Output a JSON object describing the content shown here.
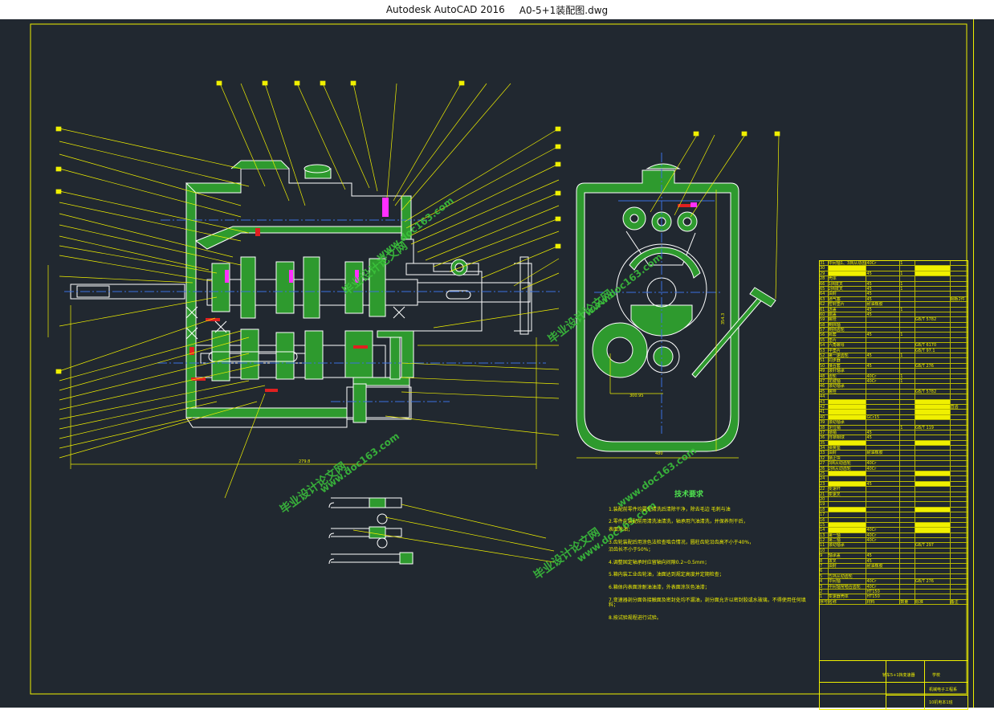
{
  "window": {
    "app_name": "Autodesk AutoCAD 2016",
    "file_name": "A0-5+1装配图.dwg"
  },
  "notes": {
    "title": "技术要求",
    "lines": [
      "1.装配前零件均要先清洗后清除干净，除去毛边 毛刺与油",
      "2.零件在装配前用清洗油清洗，轴承用汽油清洗，并保养剂干后，",
      "3.齿轮装配后用涂色法检查啮合情况，圆柱齿轮沿齿高不小于40%，",
      "4.调整固定轴承时应留轴向间隙0.2~0.5mm；",
      "5.箱内装工业齿轮油，油面达到规定高度并定期检查；",
      "6.箱体内表面涂耐油油漆，外表面涂灰色油漆；",
      "7.变速器剖分面各接触面及密封处均不漏油，剖分面允许以密封胶或水玻璃，不得使用任何填料；",
      "8.按试验规程进行试验。"
    ],
    "sub_lines": [
      "表面涂油；",
      "沿齿长不小于50%；"
    ]
  },
  "watermarks": [
    {
      "text": "毕业设计论文网",
      "size": 14
    },
    {
      "text": "www.doc163.com",
      "size": 12
    }
  ],
  "title_block": {
    "drawing_name": "轿车5+1挡变速器",
    "school": "学校",
    "dept": "机械电子工程系",
    "code": "10机电本1班"
  },
  "dimensions": {
    "width_main": "279.8",
    "width_side": "480",
    "height_side": "354.3",
    "center": "300.95"
  },
  "parts_table": {
    "rows": [
      [
        "31",
        "中间轴1、3挡从动齿轮",
        "40Cr",
        "1",
        "",
        ""
      ],
      [
        "30",
        "",
        "",
        "",
        "",
        ""
      ],
      [
        "29",
        "垫片",
        "45",
        "1",
        "",
        ""
      ],
      [
        "28",
        "壳体",
        "",
        "",
        "",
        ""
      ],
      [
        "66",
        "1挡拨叉",
        "45",
        "1",
        "",
        ""
      ],
      [
        "65",
        "2挡拨叉",
        "45",
        "1",
        "",
        ""
      ],
      [
        "64",
        "油封",
        "45",
        "",
        "",
        ""
      ],
      [
        "63",
        "通气塞",
        "45",
        "",
        "",
        "钢板2件"
      ],
      [
        "62",
        "密封垫片",
        "耐油橡胶",
        "",
        "",
        ""
      ],
      [
        "61",
        "透盖",
        "45",
        "1",
        "",
        ""
      ],
      [
        "60",
        "端盖",
        "45",
        "",
        "",
        ""
      ],
      [
        "59",
        "螺栓",
        "",
        "",
        "GB/T 5782",
        ""
      ],
      [
        "58",
        "倒挡轴",
        "",
        "",
        "",
        ""
      ],
      [
        "57",
        "倒挡齿轮",
        "",
        "",
        "",
        ""
      ],
      [
        "56",
        "隔套",
        "45",
        "1",
        "",
        ""
      ],
      [
        "55",
        "垫片",
        "",
        "",
        "",
        ""
      ],
      [
        "54",
        "六角螺母",
        "",
        "",
        "GB/T 6170",
        ""
      ],
      [
        "53",
        "平垫片",
        "",
        "",
        "GB/T 97.1",
        ""
      ],
      [
        "52",
        "第一速齿轮",
        "45",
        "1",
        "",
        ""
      ],
      [
        "51",
        "同步器",
        "",
        "",
        "",
        ""
      ],
      [
        "50",
        "接合套",
        "45",
        "",
        "GB/T 276",
        ""
      ],
      [
        "49",
        "滚针轴承",
        "",
        "",
        "",
        ""
      ],
      [
        "48",
        "齿轮",
        "40Cr",
        "1",
        "",
        ""
      ],
      [
        "47",
        "花键轴",
        "40Cr",
        "1",
        "",
        ""
      ],
      [
        "46",
        "滚动轴承",
        "",
        "",
        "",
        ""
      ],
      [
        "45",
        "螺栓",
        "",
        "",
        "GB/T 5782",
        ""
      ],
      [
        "44",
        "",
        "",
        "",
        "",
        ""
      ],
      [
        "43",
        "",
        "",
        "",
        "",
        ""
      ],
      [
        "42",
        "",
        "",
        "",
        "",
        "直齿"
      ],
      [
        "41",
        "",
        "",
        "",
        "",
        ""
      ],
      [
        "40",
        "滚针轴承",
        "GCr15",
        "",
        "",
        ""
      ],
      [
        "39",
        "滚动轴承",
        "",
        "",
        "",
        ""
      ],
      [
        "38",
        "定位销",
        "",
        "1",
        "GB/T 119",
        ""
      ],
      [
        "37",
        "锁销",
        "45",
        "",
        "",
        ""
      ],
      [
        "36",
        "自锁钢球",
        "45",
        "",
        "",
        ""
      ],
      [
        "35",
        "压缩弹簧",
        "",
        "",
        "GB/T 2089",
        ""
      ],
      [
        "34",
        "弹簧座",
        "",
        "",
        "",
        ""
      ],
      [
        "33",
        "油封",
        "耐油橡胶",
        "",
        "",
        ""
      ],
      [
        "32",
        "锁止块",
        "",
        "",
        "",
        ""
      ],
      [
        "27",
        "3挡从动齿轮",
        "40Cr",
        "",
        "",
        ""
      ],
      [
        "26",
        "2挡从动齿轮",
        "40Cr",
        "",
        "",
        ""
      ],
      [
        "25",
        "",
        "",
        "",
        "",
        ""
      ],
      [
        "24",
        "",
        "",
        "",
        "",
        ""
      ],
      [
        "23",
        "拨叉轴",
        "45",
        "",
        "",
        ""
      ],
      [
        "22",
        "变速杆",
        "",
        "",
        "",
        ""
      ],
      [
        "21",
        "变速叉",
        "",
        "",
        "",
        ""
      ],
      [
        "20",
        "",
        "",
        "",
        "",
        ""
      ],
      [
        "19",
        "",
        "",
        "",
        "",
        ""
      ],
      [
        "18",
        "",
        "",
        "",
        "",
        ""
      ],
      [
        "17",
        "",
        "",
        "",
        "",
        ""
      ],
      [
        "16",
        "",
        "",
        "",
        "",
        ""
      ],
      [
        "15",
        "",
        "",
        "",
        "",
        ""
      ],
      [
        "14",
        "五挡从动齿轮",
        "40Cr",
        "",
        "GB/T 276",
        ""
      ],
      [
        "13",
        "第一轴",
        "40Cr",
        "",
        "",
        ""
      ],
      [
        "12",
        "第二轴",
        "40Cr",
        "",
        "",
        ""
      ],
      [
        "11",
        "滚动轴承",
        "",
        "",
        "GB/T 297",
        ""
      ],
      [
        "10",
        "",
        "",
        "",
        "",
        ""
      ],
      [
        "9",
        "轴承盖",
        "45",
        "",
        "",
        ""
      ],
      [
        "8",
        "拨叉",
        "45",
        "",
        "",
        ""
      ],
      [
        "7",
        "油封",
        "耐油橡胶",
        "",
        "",
        ""
      ],
      [
        "6",
        "",
        "",
        "",
        "",
        ""
      ],
      [
        "5",
        "五挡从动齿轮",
        "",
        "",
        "",
        ""
      ],
      [
        "4",
        "中间轴",
        "40Cr",
        "",
        "GB/T 276",
        ""
      ],
      [
        "3",
        "中间轴常啮合齿轮",
        "40Cr",
        "",
        "",
        ""
      ],
      [
        "2",
        "",
        "HT150",
        "",
        "",
        ""
      ],
      [
        "1",
        "变速器壳体",
        "HT150",
        "",
        "",
        ""
      ],
      [
        "序号",
        "名称",
        "材料",
        "数量",
        "标准",
        "备注"
      ]
    ],
    "highlight_rows": [
      1,
      2,
      27,
      28,
      29,
      30,
      35,
      41,
      43,
      48,
      51,
      52
    ]
  }
}
